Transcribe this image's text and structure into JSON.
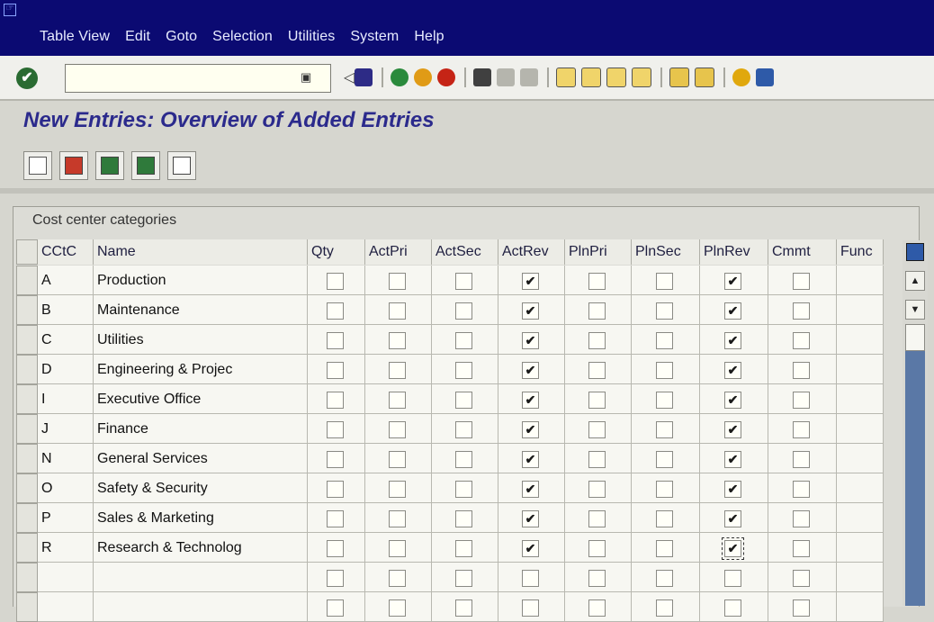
{
  "menu": {
    "items": [
      "Table View",
      "Edit",
      "Goto",
      "Selection",
      "Utilities",
      "System",
      "Help"
    ]
  },
  "toolbar": {
    "command_value": "",
    "icons": [
      "enter-icon",
      "save-icon",
      "back-icon",
      "exit-icon",
      "cancel-icon",
      "print-icon",
      "find-icon",
      "find-next-icon",
      "first-page-icon",
      "previous-page-icon",
      "next-page-icon",
      "last-page-icon",
      "create-session-icon",
      "shortcut-icon",
      "help-icon",
      "layout-icon"
    ]
  },
  "page": {
    "title": "New Entries: Overview of Added Entries"
  },
  "table": {
    "title": "Cost center categories",
    "columns": [
      "CCtC",
      "Name",
      "Qty",
      "ActPri",
      "ActSec",
      "ActRev",
      "PlnPri",
      "PlnSec",
      "PlnRev",
      "Cmmt",
      "Func"
    ],
    "rows": [
      {
        "cctc": "A",
        "name": "Production",
        "checks": [
          false,
          false,
          false,
          true,
          false,
          false,
          true,
          false
        ]
      },
      {
        "cctc": "B",
        "name": "Maintenance",
        "checks": [
          false,
          false,
          false,
          true,
          false,
          false,
          true,
          false
        ]
      },
      {
        "cctc": "C",
        "name": "Utilities",
        "checks": [
          false,
          false,
          false,
          true,
          false,
          false,
          true,
          false
        ]
      },
      {
        "cctc": "D",
        "name": "Engineering & Projec",
        "checks": [
          false,
          false,
          false,
          true,
          false,
          false,
          true,
          false
        ]
      },
      {
        "cctc": "I",
        "name": "Executive Office",
        "checks": [
          false,
          false,
          false,
          true,
          false,
          false,
          true,
          false
        ]
      },
      {
        "cctc": "J",
        "name": "Finance",
        "checks": [
          false,
          false,
          false,
          true,
          false,
          false,
          true,
          false
        ]
      },
      {
        "cctc": "N",
        "name": "General Services",
        "checks": [
          false,
          false,
          false,
          true,
          false,
          false,
          true,
          false
        ]
      },
      {
        "cctc": "O",
        "name": "Safety & Security",
        "checks": [
          false,
          false,
          false,
          true,
          false,
          false,
          true,
          false
        ]
      },
      {
        "cctc": "P",
        "name": "Sales & Marketing",
        "checks": [
          false,
          false,
          false,
          true,
          false,
          false,
          true,
          false
        ]
      },
      {
        "cctc": "R",
        "name": "Research & Technolog",
        "checks": [
          false,
          false,
          false,
          true,
          false,
          false,
          true,
          false
        ]
      },
      {
        "cctc": "",
        "name": "",
        "checks": [
          false,
          false,
          false,
          false,
          false,
          false,
          false,
          false
        ]
      },
      {
        "cctc": "",
        "name": "",
        "checks": [
          false,
          false,
          false,
          false,
          false,
          false,
          false,
          false
        ]
      }
    ]
  }
}
